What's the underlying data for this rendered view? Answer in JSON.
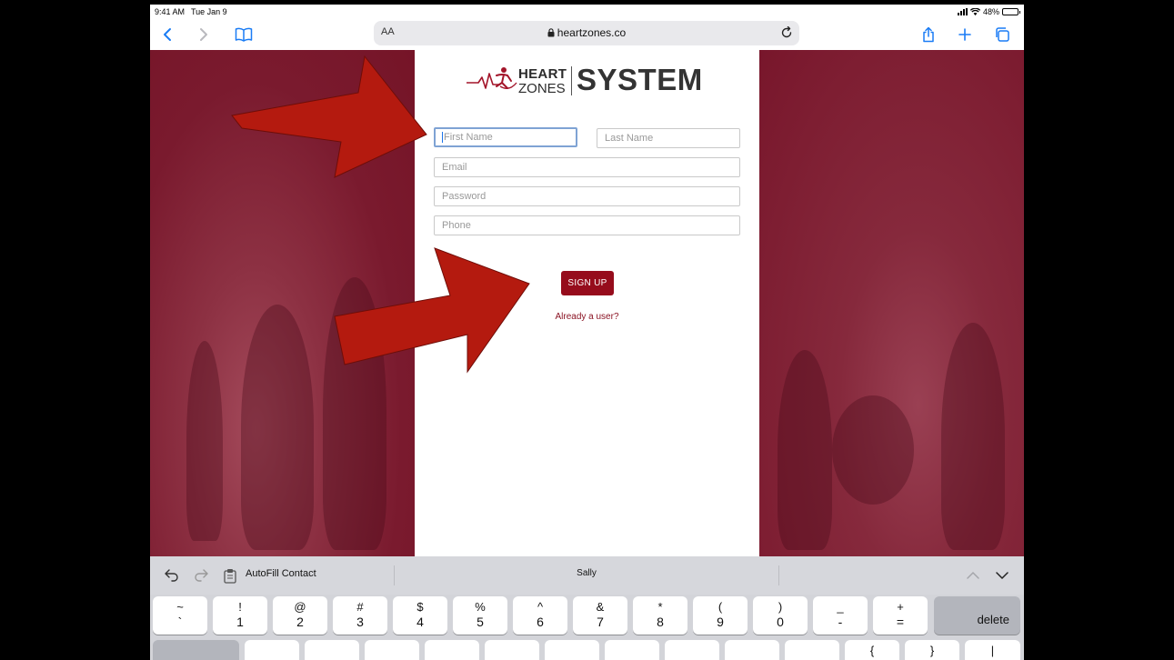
{
  "status_bar": {
    "time": "9:41 AM",
    "date": "Tue Jan 9",
    "battery": "48%",
    "battery_level": 0.48
  },
  "browser": {
    "text_size_label": "AA",
    "url": "heartzones.co"
  },
  "logo": {
    "heart": "HEART",
    "zones": "ZONES",
    "system": "SYSTEM"
  },
  "form": {
    "first_name_placeholder": "First Name",
    "last_name_placeholder": "Last Name",
    "email_placeholder": "Email",
    "password_placeholder": "Password",
    "phone_placeholder": "Phone",
    "signup_label": "SIGN UP",
    "already_user_label": "Already a user?"
  },
  "keyboard": {
    "autofill_label": "AutoFill Contact",
    "suggestion": "Sally",
    "delete_label": "delete",
    "number_row": [
      {
        "top": "~",
        "bottom": "`"
      },
      {
        "top": "!",
        "bottom": "1"
      },
      {
        "top": "@",
        "bottom": "2"
      },
      {
        "top": "#",
        "bottom": "3"
      },
      {
        "top": "$",
        "bottom": "4"
      },
      {
        "top": "%",
        "bottom": "5"
      },
      {
        "top": "^",
        "bottom": "6"
      },
      {
        "top": "&",
        "bottom": "7"
      },
      {
        "top": "*",
        "bottom": "8"
      },
      {
        "top": "(",
        "bottom": "9"
      },
      {
        "top": ")",
        "bottom": "0"
      },
      {
        "top": "_",
        "bottom": "-"
      },
      {
        "top": "+",
        "bottom": "="
      }
    ],
    "second_row_partial": [
      "{",
      "}",
      "|"
    ]
  },
  "colors": {
    "brand_red": "#960c1c",
    "background_maroon": "#7a1526",
    "arrow_red": "#b41a0f",
    "focus_blue": "#7fa3d4"
  }
}
